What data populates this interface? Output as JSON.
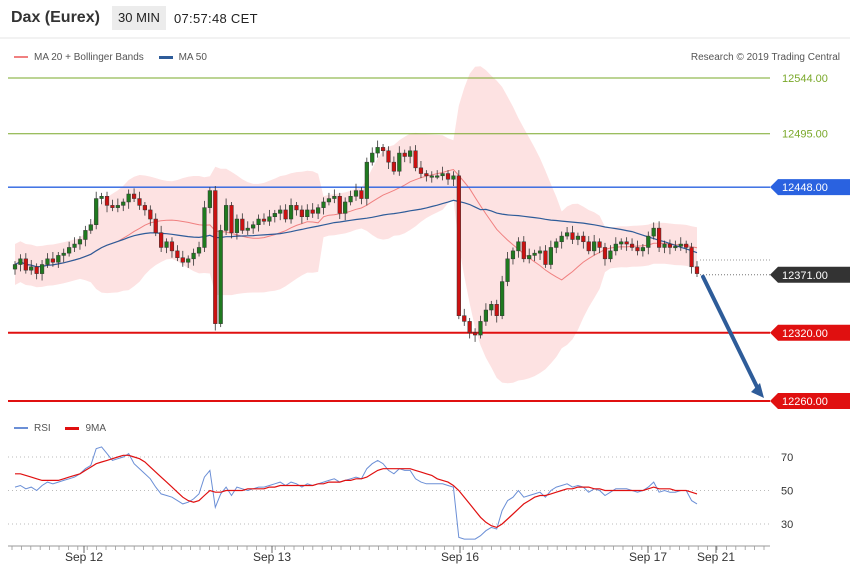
{
  "header": {
    "instrument": "Dax (Eurex)",
    "timeframe": "30 MIN",
    "time": "07:57:48 CET"
  },
  "legend": {
    "items": [
      {
        "label": "MA 20 + Bollinger Bands",
        "color": "#f08080"
      },
      {
        "label": "MA 50",
        "color": "#2e5c99"
      }
    ],
    "credit": "Research © 2019 Trading Central"
  },
  "rsi_legend": {
    "items": [
      {
        "label": "RSI",
        "color": "#6b8fd6"
      },
      {
        "label": "9MA",
        "color": "#e01010"
      }
    ]
  },
  "chart_data": {
    "type": "candlestick",
    "price_ylim": [
      12250,
      12570
    ],
    "levels": [
      {
        "value": 12544,
        "label": "12544.00",
        "kind": "target",
        "color": "#7aa82a"
      },
      {
        "value": 12495,
        "label": "12495.00",
        "kind": "target",
        "color": "#7aa82a"
      },
      {
        "value": 12448,
        "label": "12448.00",
        "kind": "pivot",
        "color": "#2a62e0"
      },
      {
        "value": 12371,
        "label": "12371.00",
        "kind": "last",
        "color": "#333333"
      },
      {
        "value": 12320,
        "label": "12320.00",
        "kind": "support",
        "color": "#e01010"
      },
      {
        "value": 12260,
        "label": "12260.00",
        "kind": "support",
        "color": "#e01010"
      }
    ],
    "last_price": 12371,
    "forecast": {
      "from": 12371,
      "to": 12260
    },
    "x_labels": [
      "Sep 12",
      "Sep 13",
      "Sep 16",
      "Sep 17",
      "Sep 21"
    ],
    "closes": [
      12380,
      12385,
      12375,
      12378,
      12372,
      12380,
      12385,
      12382,
      12388,
      12390,
      12395,
      12398,
      12402,
      12410,
      12415,
      12438,
      12440,
      12432,
      12430,
      12432,
      12435,
      12442,
      12438,
      12432,
      12428,
      12420,
      12408,
      12395,
      12400,
      12392,
      12386,
      12382,
      12385,
      12390,
      12395,
      12430,
      12445,
      12328,
      12410,
      12432,
      12408,
      12420,
      12410,
      12412,
      12415,
      12420,
      12418,
      12422,
      12425,
      12428,
      12420,
      12432,
      12428,
      12422,
      12428,
      12425,
      12430,
      12435,
      12438,
      12440,
      12425,
      12435,
      12440,
      12445,
      12438,
      12470,
      12478,
      12483,
      12480,
      12470,
      12462,
      12478,
      12475,
      12480,
      12465,
      12460,
      12458,
      12458,
      12458,
      12460,
      12455,
      12458,
      12335,
      12330,
      12320,
      12318,
      12330,
      12340,
      12345,
      12335,
      12365,
      12385,
      12392,
      12400,
      12385,
      12388,
      12390,
      12392,
      12380,
      12395,
      12400,
      12405,
      12408,
      12402,
      12405,
      12400,
      12392,
      12400,
      12395,
      12385,
      12392,
      12398,
      12400,
      12398,
      12395,
      12392,
      12395,
      12405,
      12412,
      12395,
      12398,
      12395,
      12396,
      12398,
      12395,
      12378,
      12372
    ],
    "rsi": {
      "ylim": [
        20,
        80
      ],
      "ticks": [
        70,
        50,
        30
      ],
      "rsi_values": [
        52,
        53,
        51,
        52,
        50,
        53,
        55,
        54,
        55,
        56,
        57,
        58,
        60,
        63,
        65,
        75,
        76,
        72,
        68,
        69,
        70,
        72,
        66,
        63,
        60,
        57,
        52,
        48,
        47,
        46,
        44,
        42,
        43,
        45,
        48,
        58,
        62,
        40,
        48,
        52,
        47,
        52,
        51,
        50,
        51,
        52,
        52,
        53,
        54,
        55,
        53,
        55,
        54,
        52,
        54,
        53,
        54,
        55,
        56,
        57,
        55,
        56,
        57,
        58,
        57,
        63,
        66,
        68,
        66,
        62,
        60,
        63,
        62,
        62,
        57,
        55,
        54,
        54,
        54,
        54,
        53,
        52,
        22,
        21,
        21,
        21,
        23,
        26,
        28,
        27,
        38,
        44,
        46,
        50,
        46,
        47,
        48,
        49,
        46,
        50,
        52,
        53,
        54,
        52,
        53,
        52,
        49,
        51,
        50,
        47,
        49,
        51,
        51,
        51,
        50,
        49,
        50,
        52,
        55,
        49,
        50,
        49,
        49,
        50,
        50,
        44,
        42
      ],
      "ma_values": [
        60,
        60,
        59,
        58,
        57,
        56,
        56,
        56,
        56,
        57,
        58,
        59,
        60,
        62,
        64,
        66,
        67,
        68,
        69,
        70,
        71,
        71,
        70,
        69,
        67,
        64,
        61,
        58,
        55,
        52,
        49,
        46,
        44,
        43,
        44,
        47,
        50,
        49,
        49,
        50,
        50,
        50,
        50,
        51,
        51,
        51,
        51,
        52,
        52,
        53,
        53,
        53,
        53,
        53,
        53,
        53,
        54,
        54,
        55,
        55,
        55,
        56,
        56,
        57,
        57,
        58,
        60,
        62,
        63,
        63,
        63,
        63,
        63,
        63,
        62,
        61,
        60,
        59,
        57,
        56,
        55,
        53,
        50,
        46,
        42,
        38,
        34,
        31,
        29,
        28,
        30,
        33,
        36,
        39,
        42,
        44,
        46,
        47,
        47,
        48,
        49,
        50,
        51,
        51,
        52,
        52,
        52,
        51,
        51,
        50,
        50,
        50,
        50,
        50,
        50,
        50,
        50,
        51,
        52,
        51,
        51,
        51,
        50,
        50,
        50,
        49,
        48
      ]
    }
  }
}
